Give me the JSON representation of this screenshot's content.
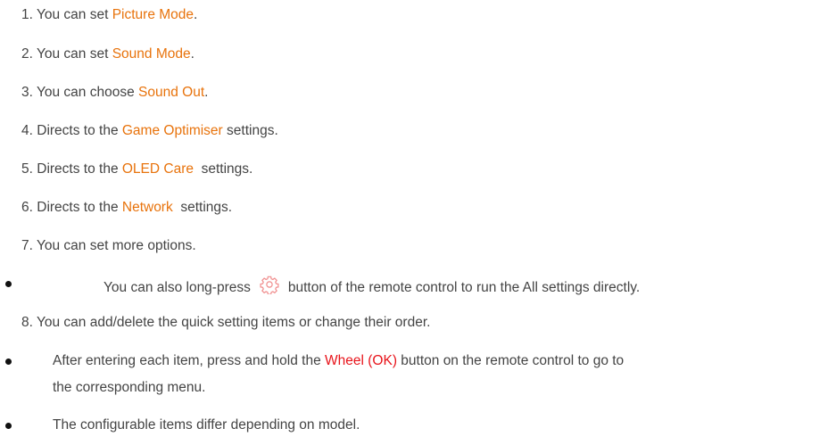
{
  "items": [
    {
      "num": "1.",
      "pre": "You can set ",
      "hl": "Picture Mode",
      "post": "."
    },
    {
      "num": "2.",
      "pre": "You can set ",
      "hl": "Sound Mode",
      "post": "."
    },
    {
      "num": "3.",
      "pre": "You can choose ",
      "hl": "Sound Out",
      "post": "."
    },
    {
      "num": "4.",
      "pre": "Directs to the ",
      "hl": "Game Optimiser",
      "post": " settings."
    },
    {
      "num": "5.",
      "pre": "Directs to the ",
      "hl": "OLED Care",
      "post": "  settings."
    },
    {
      "num": "6.",
      "pre": "Directs to the ",
      "hl": "Network",
      "post": "  settings."
    },
    {
      "num": "7.",
      "text": "You can set more options."
    },
    {
      "num": "8.",
      "text": "You can add/delete the quick setting items or change their order."
    }
  ],
  "bullets": {
    "long_press": {
      "pre": "You can also long-press",
      "icon": "gear-icon",
      "post": "button of the remote control to run the All settings directly."
    },
    "wheel": {
      "pre": "After entering each item, press and hold the ",
      "hl": "Wheel (OK)",
      "post": " button on the remote control to go to",
      "line2": "the corresponding menu."
    },
    "configurable": {
      "text": "The configurable items differ depending on model."
    }
  },
  "colors": {
    "highlight_orange": "#e8730c",
    "highlight_red": "#e8141b",
    "icon_pink": "#f08c8c"
  }
}
